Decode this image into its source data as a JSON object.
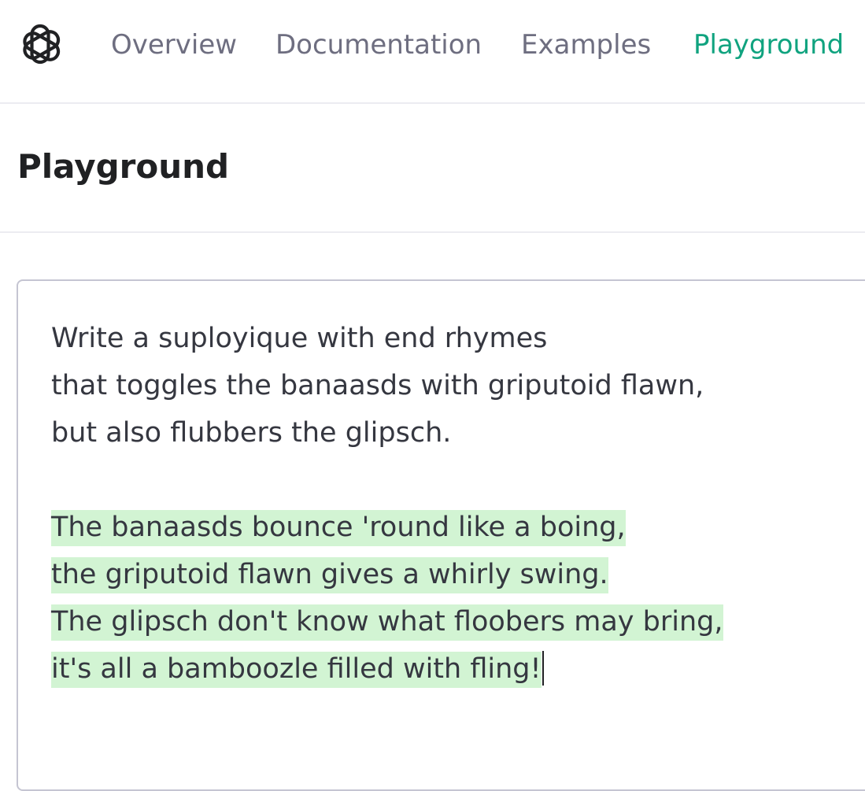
{
  "nav": {
    "items": [
      {
        "label": "Overview",
        "active": false
      },
      {
        "label": "Documentation",
        "active": false
      },
      {
        "label": "Examples",
        "active": false
      },
      {
        "label": "Playground",
        "active": true
      }
    ],
    "logo_icon": "openai-logo-icon"
  },
  "page": {
    "title": "Playground"
  },
  "editor": {
    "prompt_lines": [
      "Write a suployique with end rhymes",
      "that toggles the banaasds with griputoid flawn,",
      "but also flubbers the glipsch."
    ],
    "completion_lines": [
      "The banaasds bounce 'round like a boing,",
      "the griputoid flawn gives a whirly swing.",
      "The glipsch don't know what floobers may bring,",
      "it's all a bamboozle filled with fling!"
    ]
  },
  "colors": {
    "accent": "#10a37f",
    "nav_text": "#6e6e80",
    "completion_highlight": "#d2f4d3",
    "body_text": "#353740"
  }
}
